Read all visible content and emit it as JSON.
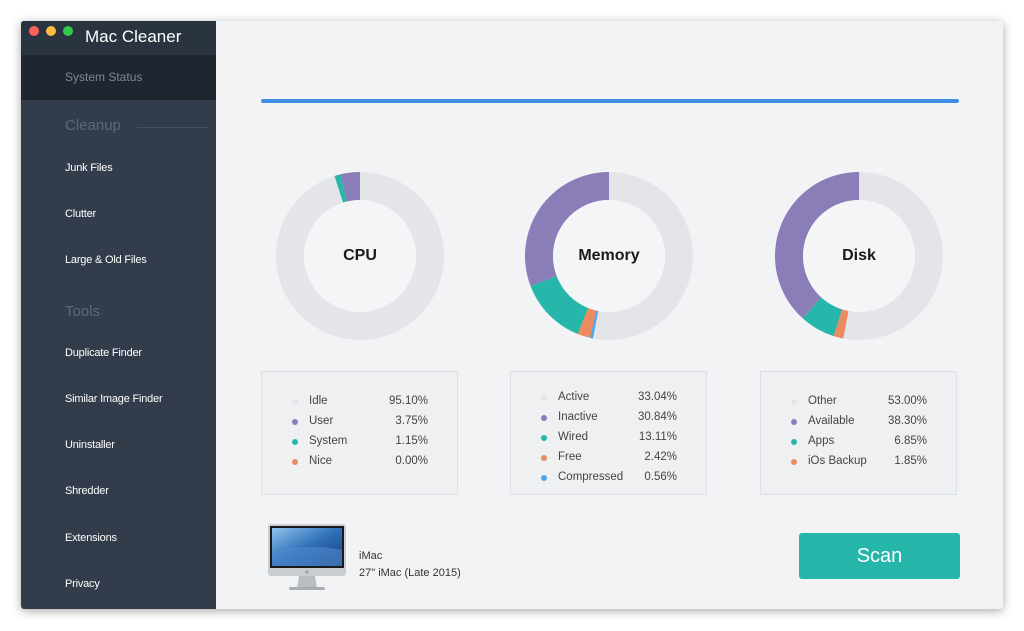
{
  "app": {
    "title": "Mac Cleaner"
  },
  "sidebar": {
    "status_label": "System Status",
    "cleanup": {
      "title": "Cleanup",
      "items": [
        {
          "label": "Junk Files"
        },
        {
          "label": "Clutter"
        },
        {
          "label": "Large & Old Files"
        }
      ]
    },
    "tools": {
      "title": "Tools",
      "items": [
        {
          "label": "Duplicate Finder"
        },
        {
          "label": "Similar Image Finder"
        },
        {
          "label": "Uninstaller"
        },
        {
          "label": "Shredder"
        },
        {
          "label": "Extensions"
        },
        {
          "label": "Privacy"
        }
      ]
    }
  },
  "progress": {
    "value": 1.0,
    "color": "#3e8ee6"
  },
  "gauges": [
    {
      "title": "CPU",
      "rows": [
        {
          "label": "Idle",
          "value": "95.10%",
          "percent": 95.1,
          "color": "#e4e5e8"
        },
        {
          "label": "User",
          "value": "3.75%",
          "percent": 3.75,
          "color": "#8b7db8"
        },
        {
          "label": "System",
          "value": "1.15%",
          "percent": 1.15,
          "color": "#26b7aa"
        },
        {
          "label": "Nice",
          "value": "0.00%",
          "percent": 0.0,
          "color": "#ec8a60"
        }
      ]
    },
    {
      "title": "Memory",
      "rows": [
        {
          "label": "Active",
          "value": "33.04%",
          "percent": 33.04,
          "color": "#e4e5e8"
        },
        {
          "label": "Inactive",
          "value": "30.84%",
          "percent": 30.84,
          "color": "#8b7db8"
        },
        {
          "label": "Wired",
          "value": "13.11%",
          "percent": 13.11,
          "color": "#26b7aa"
        },
        {
          "label": "Free",
          "value": "2.42%",
          "percent": 2.42,
          "color": "#ec8a60"
        },
        {
          "label": "Compressed",
          "value": "0.56%",
          "percent": 0.56,
          "color": "#4ea8e8"
        }
      ]
    },
    {
      "title": "Disk",
      "rows": [
        {
          "label": "Other",
          "value": "53.00%",
          "percent": 53.0,
          "color": "#e4e5e8"
        },
        {
          "label": "Available",
          "value": "38.30%",
          "percent": 38.3,
          "color": "#8b7db8"
        },
        {
          "label": "Apps",
          "value": "6.85%",
          "percent": 6.85,
          "color": "#26b7aa"
        },
        {
          "label": "iOs Backup",
          "value": "1.85%",
          "percent": 1.85,
          "color": "#ec8a60"
        }
      ]
    }
  ],
  "device": {
    "name": "iMac",
    "model": "27\" iMac (Late 2015)",
    "icon": "imac-icon"
  },
  "scan": {
    "label": "Scan",
    "color": "#26b7aa"
  }
}
